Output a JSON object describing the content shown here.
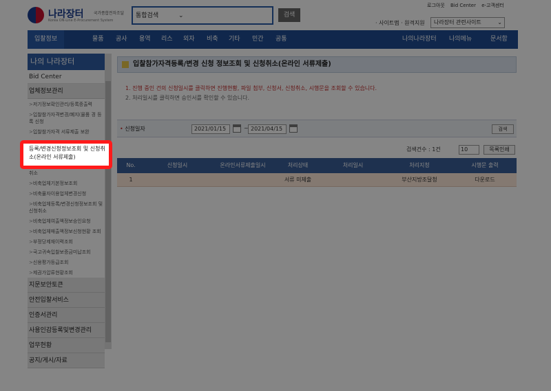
{
  "header": {
    "logo_title": "나라장터",
    "logo_sub1": "국가종합전자조달",
    "logo_sub2": "Korea ON-Line E-Procurement System",
    "search_scope": "통합검색",
    "search_button": "검색",
    "util_links": [
      "로그아웃",
      "Bid Center",
      "e-고객센터"
    ],
    "sitemap_text": "· 사이트맵 · 원격지원",
    "related_site": "나라장터 관련사이트"
  },
  "nav": {
    "items": [
      "입찰정보",
      "물품",
      "공사",
      "용역",
      "리스",
      "외자",
      "비축",
      "기타",
      "민간",
      "공통"
    ],
    "right_items": [
      "나의나라장터",
      "나의메뉴",
      "문서함"
    ]
  },
  "sidebar": {
    "title": "나의 나라장터",
    "bid_center": "Bid Center",
    "section1": "업체정보관리",
    "sub_items": [
      "저기정보확인관리/등록증출력",
      "입찰참가자격변경/폐지(물품 경 등록 신청",
      "입찰참가자격 서류제출 보완",
      "등록/변경신청정보조회 및 신청취소(온라인 서류제출)",
      "영문정보변경신청정보조회 및 신청취소",
      "비축업체기본정보조회",
      "비축물자이용업체변경신청",
      "비축업체등록/변경신청정보조회 및 신청취소",
      "비축업체여출액정보승인요청",
      "비축업체매출액정보신청현황 조회",
      "부정당제재이력조회",
      "국고귀속입찰보증금미납조회",
      "신용평가등급조회",
      "제권가압류현황조회"
    ],
    "sections": [
      "지문보안토큰",
      "안전입찰서비스",
      "인증서관리",
      "사용인감등록및변경관리",
      "업무현황",
      "공지/게시/자료"
    ]
  },
  "main": {
    "title": "입찰참가자격등록/변경 신청 정보조회 및 신청취소(온라인 서류제출)",
    "notice1": "1. 진행 중인 건의 신청일시를 클릭하면 진행현황, 파일 첨부, 신청서, 신청취소, 시행문을 조회할 수 있습니다.",
    "notice2": "2. 처리일시를 클릭하면 승인서를 확인할 수 있습니다.",
    "cond_label": "신청일자",
    "date_from": "2021/01/15",
    "date_to": "2021/04/15",
    "search_label": "검색",
    "result_count": "검색건수 : 1건",
    "per_page": "10",
    "print_label": "목록인쇄",
    "columns": [
      "No.",
      "신청일시",
      "온라인서류제출일시",
      "처리상태",
      "처리일시",
      "처리지청",
      "시행문 출력"
    ],
    "rows": [
      [
        "1",
        "",
        "",
        "서류 미제출",
        "",
        "부산지방조달청",
        "다운로드"
      ]
    ]
  }
}
